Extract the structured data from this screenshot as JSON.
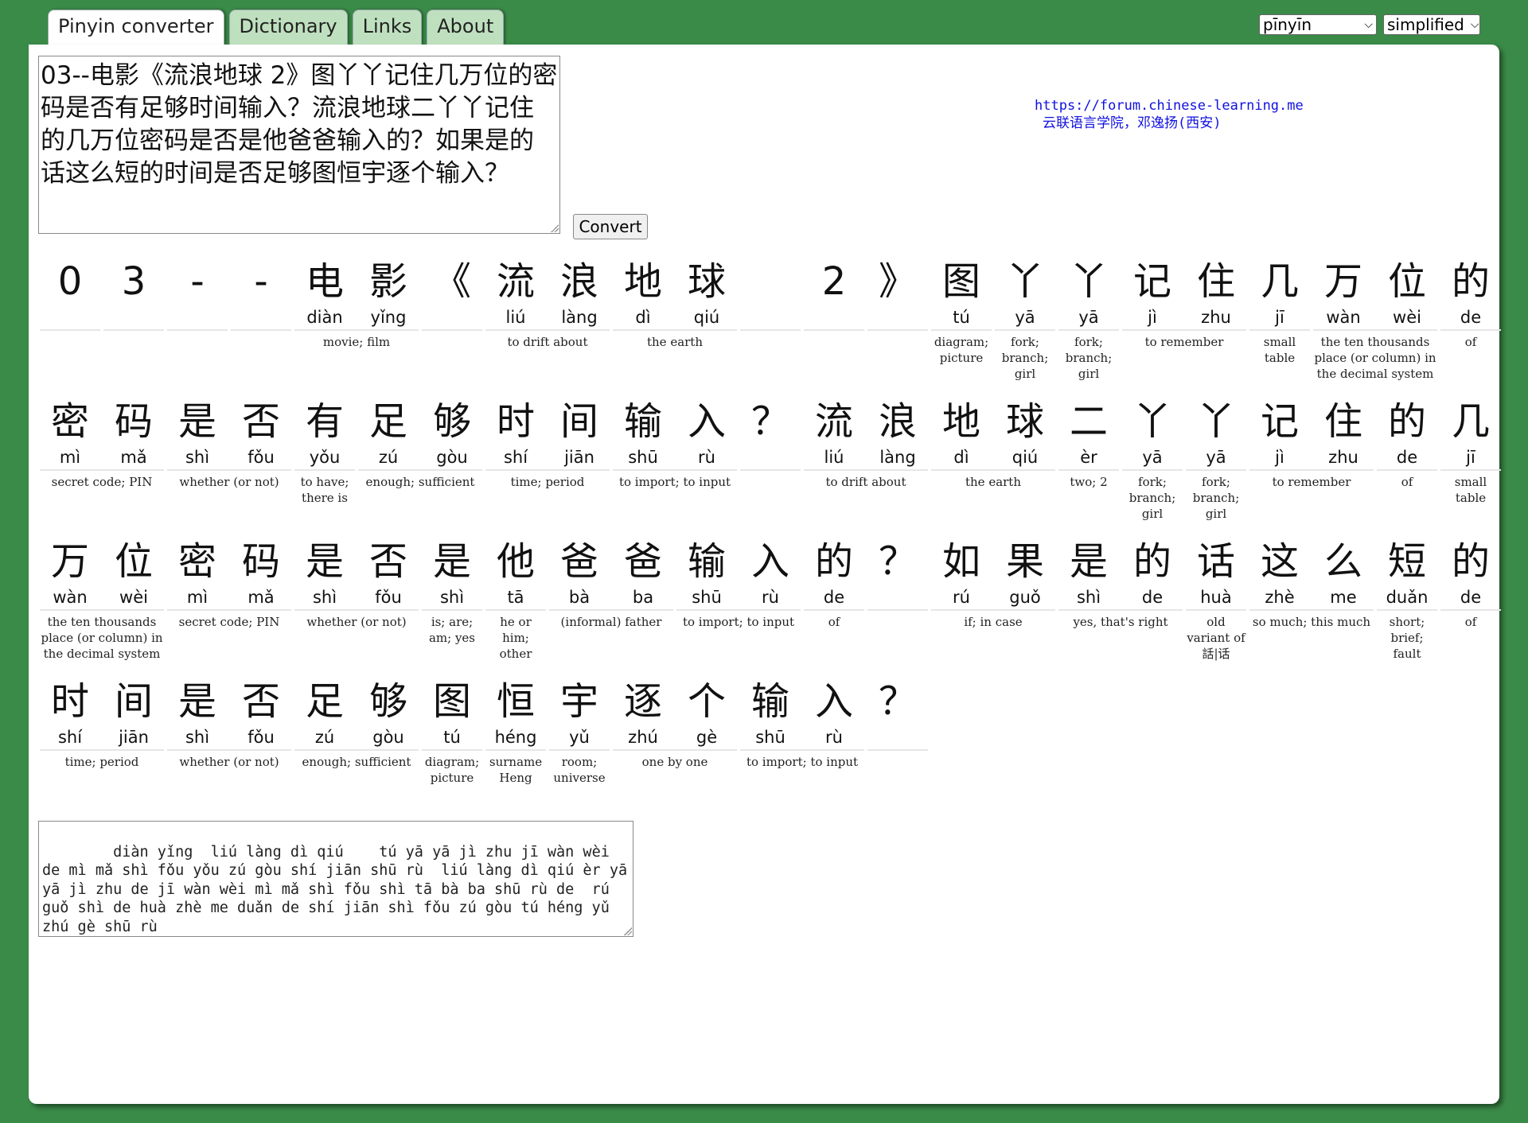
{
  "tabs": [
    {
      "label": "Pinyin converter",
      "active": true
    },
    {
      "label": "Dictionary",
      "active": false
    },
    {
      "label": "Links",
      "active": false
    },
    {
      "label": "About",
      "active": false
    }
  ],
  "selects": {
    "tone_mode": "pīnyīn",
    "script": "simplified"
  },
  "input_text": "03--电影《流浪地球 2》图丫丫记住几万位的密码是否有足够时间输入？流浪地球二丫丫记住的几万位密码是否是他爸爸输入的？如果是的话这么短的时间是否足够图恒宇逐个输入？",
  "convert_label": "Convert",
  "credit": {
    "url": "https://forum.chinese-learning.me",
    "org": "云联语言学院，邓逸扬(西安)"
  },
  "rows": [
    {
      "chars": [
        {
          "hz": "0",
          "py": ""
        },
        {
          "hz": "3",
          "py": ""
        },
        {
          "hz": "-",
          "py": ""
        },
        {
          "hz": "-",
          "py": ""
        },
        {
          "hz": "电",
          "py": "diàn"
        },
        {
          "hz": "影",
          "py": "yǐng"
        },
        {
          "hz": "《",
          "py": ""
        },
        {
          "hz": "流",
          "py": "liú"
        },
        {
          "hz": "浪",
          "py": "làng"
        },
        {
          "hz": "地",
          "py": "dì"
        },
        {
          "hz": "球",
          "py": "qiú"
        },
        {
          "hz": "",
          "py": ""
        },
        {
          "hz": "2",
          "py": ""
        },
        {
          "hz": "》",
          "py": ""
        },
        {
          "hz": "图",
          "py": "tú"
        },
        {
          "hz": "丫",
          "py": "yā"
        },
        {
          "hz": "丫",
          "py": "yā"
        },
        {
          "hz": "记",
          "py": "jì"
        },
        {
          "hz": "住",
          "py": "zhu"
        },
        {
          "hz": "几",
          "py": "jī"
        },
        {
          "hz": "万",
          "py": "wàn"
        },
        {
          "hz": "位",
          "py": "wèi"
        },
        {
          "hz": "的",
          "py": "de"
        }
      ],
      "groups": [
        {
          "start": 0,
          "len": 1,
          "gloss": ""
        },
        {
          "start": 1,
          "len": 1,
          "gloss": ""
        },
        {
          "start": 2,
          "len": 1,
          "gloss": ""
        },
        {
          "start": 3,
          "len": 1,
          "gloss": ""
        },
        {
          "start": 4,
          "len": 2,
          "gloss": "movie; film"
        },
        {
          "start": 6,
          "len": 1,
          "gloss": ""
        },
        {
          "start": 7,
          "len": 2,
          "gloss": "to drift about"
        },
        {
          "start": 9,
          "len": 2,
          "gloss": "the earth"
        },
        {
          "start": 11,
          "len": 1,
          "gloss": ""
        },
        {
          "start": 12,
          "len": 1,
          "gloss": ""
        },
        {
          "start": 13,
          "len": 1,
          "gloss": ""
        },
        {
          "start": 14,
          "len": 1,
          "gloss": "diagram; picture"
        },
        {
          "start": 15,
          "len": 1,
          "gloss": "fork; branch; girl"
        },
        {
          "start": 16,
          "len": 1,
          "gloss": "fork; branch; girl"
        },
        {
          "start": 17,
          "len": 2,
          "gloss": "to remember"
        },
        {
          "start": 19,
          "len": 1,
          "gloss": "small table"
        },
        {
          "start": 20,
          "len": 2,
          "gloss": "the ten thousands place (or column) in the decimal system"
        },
        {
          "start": 22,
          "len": 1,
          "gloss": "of"
        }
      ]
    },
    {
      "chars": [
        {
          "hz": "密",
          "py": "mì"
        },
        {
          "hz": "码",
          "py": "mǎ"
        },
        {
          "hz": "是",
          "py": "shì"
        },
        {
          "hz": "否",
          "py": "fǒu"
        },
        {
          "hz": "有",
          "py": "yǒu"
        },
        {
          "hz": "足",
          "py": "zú"
        },
        {
          "hz": "够",
          "py": "gòu"
        },
        {
          "hz": "时",
          "py": "shí"
        },
        {
          "hz": "间",
          "py": "jiān"
        },
        {
          "hz": "输",
          "py": "shū"
        },
        {
          "hz": "入",
          "py": "rù"
        },
        {
          "hz": "？",
          "py": ""
        },
        {
          "hz": "流",
          "py": "liú"
        },
        {
          "hz": "浪",
          "py": "làng"
        },
        {
          "hz": "地",
          "py": "dì"
        },
        {
          "hz": "球",
          "py": "qiú"
        },
        {
          "hz": "二",
          "py": "èr"
        },
        {
          "hz": "丫",
          "py": "yā"
        },
        {
          "hz": "丫",
          "py": "yā"
        },
        {
          "hz": "记",
          "py": "jì"
        },
        {
          "hz": "住",
          "py": "zhu"
        },
        {
          "hz": "的",
          "py": "de"
        },
        {
          "hz": "几",
          "py": "jī"
        }
      ],
      "groups": [
        {
          "start": 0,
          "len": 2,
          "gloss": "secret code; PIN"
        },
        {
          "start": 2,
          "len": 2,
          "gloss": "whether (or not)"
        },
        {
          "start": 4,
          "len": 1,
          "gloss": "to have; there is"
        },
        {
          "start": 5,
          "len": 2,
          "gloss": "enough; sufficient"
        },
        {
          "start": 7,
          "len": 2,
          "gloss": "time; period"
        },
        {
          "start": 9,
          "len": 2,
          "gloss": "to import; to input"
        },
        {
          "start": 11,
          "len": 1,
          "gloss": ""
        },
        {
          "start": 12,
          "len": 2,
          "gloss": "to drift about"
        },
        {
          "start": 14,
          "len": 2,
          "gloss": "the earth"
        },
        {
          "start": 16,
          "len": 1,
          "gloss": "two; 2"
        },
        {
          "start": 17,
          "len": 1,
          "gloss": "fork; branch; girl"
        },
        {
          "start": 18,
          "len": 1,
          "gloss": "fork; branch; girl"
        },
        {
          "start": 19,
          "len": 2,
          "gloss": "to remember"
        },
        {
          "start": 21,
          "len": 1,
          "gloss": "of"
        },
        {
          "start": 22,
          "len": 1,
          "gloss": "small table"
        }
      ]
    },
    {
      "chars": [
        {
          "hz": "万",
          "py": "wàn"
        },
        {
          "hz": "位",
          "py": "wèi"
        },
        {
          "hz": "密",
          "py": "mì"
        },
        {
          "hz": "码",
          "py": "mǎ"
        },
        {
          "hz": "是",
          "py": "shì"
        },
        {
          "hz": "否",
          "py": "fǒu"
        },
        {
          "hz": "是",
          "py": "shì"
        },
        {
          "hz": "他",
          "py": "tā"
        },
        {
          "hz": "爸",
          "py": "bà"
        },
        {
          "hz": "爸",
          "py": "ba"
        },
        {
          "hz": "输",
          "py": "shū"
        },
        {
          "hz": "入",
          "py": "rù"
        },
        {
          "hz": "的",
          "py": "de"
        },
        {
          "hz": "？",
          "py": ""
        },
        {
          "hz": "如",
          "py": "rú"
        },
        {
          "hz": "果",
          "py": "guǒ"
        },
        {
          "hz": "是",
          "py": "shì"
        },
        {
          "hz": "的",
          "py": "de"
        },
        {
          "hz": "话",
          "py": "huà"
        },
        {
          "hz": "这",
          "py": "zhè"
        },
        {
          "hz": "么",
          "py": "me"
        },
        {
          "hz": "短",
          "py": "duǎn"
        },
        {
          "hz": "的",
          "py": "de"
        }
      ],
      "groups": [
        {
          "start": 0,
          "len": 2,
          "gloss": "the ten thousands place (or column) in the decimal system"
        },
        {
          "start": 2,
          "len": 2,
          "gloss": "secret code; PIN"
        },
        {
          "start": 4,
          "len": 2,
          "gloss": "whether (or not)"
        },
        {
          "start": 6,
          "len": 1,
          "gloss": "is; are; am; yes"
        },
        {
          "start": 7,
          "len": 1,
          "gloss": "he or him; other"
        },
        {
          "start": 8,
          "len": 2,
          "gloss": "(informal) father"
        },
        {
          "start": 10,
          "len": 2,
          "gloss": "to import; to input"
        },
        {
          "start": 12,
          "len": 1,
          "gloss": "of"
        },
        {
          "start": 13,
          "len": 1,
          "gloss": ""
        },
        {
          "start": 14,
          "len": 2,
          "gloss": "if; in case"
        },
        {
          "start": 16,
          "len": 2,
          "gloss": "yes, that's right"
        },
        {
          "start": 18,
          "len": 1,
          "gloss": "old variant of 話|话"
        },
        {
          "start": 19,
          "len": 2,
          "gloss": "so much; this much"
        },
        {
          "start": 21,
          "len": 1,
          "gloss": "short; brief; fault"
        },
        {
          "start": 22,
          "len": 1,
          "gloss": "of"
        }
      ]
    },
    {
      "chars": [
        {
          "hz": "时",
          "py": "shí"
        },
        {
          "hz": "间",
          "py": "jiān"
        },
        {
          "hz": "是",
          "py": "shì"
        },
        {
          "hz": "否",
          "py": "fǒu"
        },
        {
          "hz": "足",
          "py": "zú"
        },
        {
          "hz": "够",
          "py": "gòu"
        },
        {
          "hz": "图",
          "py": "tú"
        },
        {
          "hz": "恒",
          "py": "héng"
        },
        {
          "hz": "宇",
          "py": "yǔ"
        },
        {
          "hz": "逐",
          "py": "zhú"
        },
        {
          "hz": "个",
          "py": "gè"
        },
        {
          "hz": "输",
          "py": "shū"
        },
        {
          "hz": "入",
          "py": "rù"
        },
        {
          "hz": "？",
          "py": ""
        }
      ],
      "groups": [
        {
          "start": 0,
          "len": 2,
          "gloss": "time; period"
        },
        {
          "start": 2,
          "len": 2,
          "gloss": "whether (or not)"
        },
        {
          "start": 4,
          "len": 2,
          "gloss": "enough; sufficient"
        },
        {
          "start": 6,
          "len": 1,
          "gloss": "diagram; picture"
        },
        {
          "start": 7,
          "len": 1,
          "gloss": "surname Heng"
        },
        {
          "start": 8,
          "len": 1,
          "gloss": "room; universe"
        },
        {
          "start": 9,
          "len": 2,
          "gloss": "one by one"
        },
        {
          "start": 11,
          "len": 2,
          "gloss": "to import; to input"
        },
        {
          "start": 13,
          "len": 1,
          "gloss": ""
        }
      ]
    }
  ],
  "output_text": "    diàn yǐng  liú làng dì qiú    tú yā yā jì zhu jī wàn wèi de mì mǎ shì fǒu yǒu zú gòu shí jiān shū rù  liú làng dì qiú èr yā yā jì zhu de jī wàn wèi mì mǎ shì fǒu shì tā bà ba shū rù de  rú guǒ shì de huà zhè me duǎn de shí jiān shì fǒu zú gòu tú héng yǔ zhú gè shū rù"
}
